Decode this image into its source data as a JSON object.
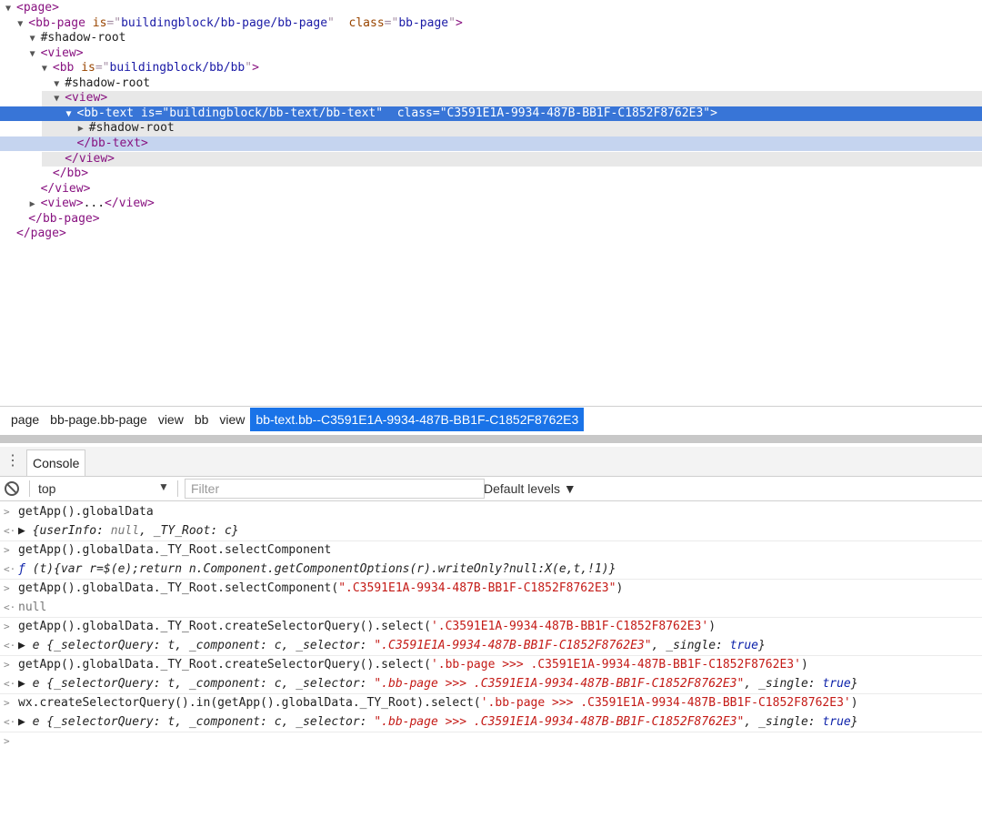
{
  "elements": {
    "nodes": [
      {
        "indent": 0,
        "tri": "▼",
        "parts": [
          [
            "tag",
            "<page"
          ],
          [
            "tag",
            ">"
          ]
        ]
      },
      {
        "indent": 1,
        "tri": "▼",
        "parts": [
          [
            "tag",
            "<bb-page"
          ],
          [
            "plain",
            " "
          ],
          [
            "attr",
            "is"
          ],
          [
            "punc",
            "=\""
          ],
          [
            "val",
            "buildingblock/bb-page/bb-page"
          ],
          [
            "punc",
            "\""
          ],
          [
            "plain",
            "  "
          ],
          [
            "attr",
            "class"
          ],
          [
            "punc",
            "=\""
          ],
          [
            "val",
            "bb-page"
          ],
          [
            "punc",
            "\""
          ],
          [
            "tag",
            ">"
          ]
        ]
      },
      {
        "indent": 2,
        "tri": "▼",
        "parts": [
          [
            "plain",
            "#shadow-root"
          ]
        ]
      },
      {
        "indent": 2,
        "tri": "▼",
        "parts": [
          [
            "tag",
            "<view"
          ],
          [
            "tag",
            ">"
          ]
        ]
      },
      {
        "indent": 3,
        "tri": "▼",
        "parts": [
          [
            "tag",
            "<bb"
          ],
          [
            "plain",
            " "
          ],
          [
            "attr",
            "is"
          ],
          [
            "punc",
            "=\""
          ],
          [
            "val",
            "buildingblock/bb/bb"
          ],
          [
            "punc",
            "\""
          ],
          [
            "tag",
            ">"
          ]
        ]
      },
      {
        "indent": 4,
        "tri": "▼",
        "parts": [
          [
            "plain",
            "#shadow-root"
          ]
        ]
      },
      {
        "indent": 4,
        "tri": "▼",
        "parts": [
          [
            "tag",
            "<view"
          ],
          [
            "tag",
            ">"
          ]
        ],
        "bg": "light"
      },
      {
        "indent": 5,
        "tri": "▼",
        "parts": [
          [
            "tag",
            "<bb-text"
          ],
          [
            "plain",
            " "
          ],
          [
            "attr",
            "is"
          ],
          [
            "punc",
            "=\""
          ],
          [
            "val",
            "buildingblock/bb-text/bb-text"
          ],
          [
            "punc",
            "\""
          ],
          [
            "plain",
            "  "
          ],
          [
            "attr",
            "class"
          ],
          [
            "punc",
            "=\""
          ],
          [
            "val",
            "C3591E1A-9934-487B-BB1F-C1852F8762E3"
          ],
          [
            "punc",
            "\""
          ],
          [
            "tag",
            ">"
          ]
        ],
        "bg": "sel"
      },
      {
        "indent": 6,
        "tri": "▶",
        "parts": [
          [
            "plain",
            "#shadow-root"
          ]
        ],
        "bg": "light"
      },
      {
        "indent": 5,
        "tri": "",
        "parts": [
          [
            "tag",
            "</bb-text"
          ],
          [
            "tag",
            ">"
          ]
        ],
        "bg": "hover"
      },
      {
        "indent": 4,
        "tri": "",
        "parts": [
          [
            "tag",
            "</view"
          ],
          [
            "tag",
            ">"
          ]
        ],
        "bg": "light"
      },
      {
        "indent": 3,
        "tri": "",
        "parts": [
          [
            "tag",
            "</bb"
          ],
          [
            "tag",
            ">"
          ]
        ]
      },
      {
        "indent": 2,
        "tri": "",
        "parts": [
          [
            "tag",
            "</view"
          ],
          [
            "tag",
            ">"
          ]
        ]
      },
      {
        "indent": 2,
        "tri": "▶",
        "parts": [
          [
            "tag",
            "<view"
          ],
          [
            "tag",
            ">"
          ],
          [
            "plain",
            "..."
          ],
          [
            "tag",
            "</view"
          ],
          [
            "tag",
            ">"
          ]
        ]
      },
      {
        "indent": 1,
        "tri": "",
        "parts": [
          [
            "tag",
            "</bb-page"
          ],
          [
            "tag",
            ">"
          ]
        ]
      },
      {
        "indent": 0,
        "tri": "",
        "parts": [
          [
            "tag",
            "</page"
          ],
          [
            "tag",
            ">"
          ]
        ]
      }
    ]
  },
  "breadcrumbs": [
    {
      "label": "page"
    },
    {
      "label": "bb-page.bb-page"
    },
    {
      "label": "view"
    },
    {
      "label": "bb"
    },
    {
      "label": "view"
    },
    {
      "label": "bb-text.bb--C3591E1A-9934-487B-BB1F-C1852F8762E3",
      "active": true
    }
  ],
  "drawer": {
    "menu_icon": "⋮",
    "tab_label": "Console"
  },
  "toolbar": {
    "context": "top",
    "context_arrow": "▼",
    "filter_placeholder": "Filter",
    "levels_label": "Default levels ▼"
  },
  "console": {
    "rows": [
      {
        "prompt": ">",
        "parts": [
          [
            "cmd",
            "getApp().globalData"
          ]
        ]
      },
      {
        "prompt": "<·",
        "parts": [
          [
            "cmd",
            "▶ "
          ],
          [
            "cmd it",
            "{userInfo: "
          ],
          [
            "gray it",
            "null"
          ],
          [
            "cmd it",
            ", _TY_Root: c}"
          ]
        ],
        "sep": true
      },
      {
        "prompt": ">",
        "parts": [
          [
            "cmd",
            "getApp().globalData._TY_Root.selectComponent"
          ]
        ]
      },
      {
        "prompt": "<·",
        "parts": [
          [
            "fn it",
            "ƒ "
          ],
          [
            "cmd it",
            "(t){var r=$(e);return n.Component.getComponentOptions(r).writeOnly?null:X(e,t,!1)}"
          ]
        ],
        "sep": true
      },
      {
        "prompt": ">",
        "parts": [
          [
            "cmd",
            "getApp().globalData._TY_Root.selectComponent("
          ],
          [
            "str",
            "\".C3591E1A-9934-487B-BB1F-C1852F8762E3\""
          ],
          [
            "cmd",
            ")"
          ]
        ]
      },
      {
        "prompt": "<·",
        "parts": [
          [
            "gray",
            "null"
          ]
        ],
        "sep": true
      },
      {
        "prompt": ">",
        "parts": [
          [
            "cmd",
            "getApp().globalData._TY_Root.createSelectorQuery().select("
          ],
          [
            "str",
            "'.C3591E1A-9934-487B-BB1F-C1852F8762E3'"
          ],
          [
            "cmd",
            ")"
          ]
        ]
      },
      {
        "prompt": "<·",
        "parts": [
          [
            "cmd",
            "▶ "
          ],
          [
            "cmd it",
            "e {_selectorQuery: t, _component: c, _selector: "
          ],
          [
            "str it",
            "\".C3591E1A-9934-487B-BB1F-C1852F8762E3\""
          ],
          [
            "cmd it",
            ", _single: "
          ],
          [
            "kw it",
            "true"
          ],
          [
            "cmd it",
            "}"
          ]
        ],
        "sep": true
      },
      {
        "prompt": ">",
        "parts": [
          [
            "cmd",
            "getApp().globalData._TY_Root.createSelectorQuery().select("
          ],
          [
            "str",
            "'.bb-page >>> .C3591E1A-9934-487B-BB1F-C1852F8762E3'"
          ],
          [
            "cmd",
            ")"
          ]
        ]
      },
      {
        "prompt": "<·",
        "parts": [
          [
            "cmd",
            "▶ "
          ],
          [
            "cmd it",
            "e {_selectorQuery: t, _component: c, _selector: "
          ],
          [
            "str it",
            "\".bb-page >>> .C3591E1A-9934-487B-BB1F-C1852F8762E3\""
          ],
          [
            "cmd it",
            ", _single: "
          ],
          [
            "kw it",
            "true"
          ],
          [
            "cmd it",
            "}"
          ]
        ],
        "sep": true
      },
      {
        "prompt": ">",
        "parts": [
          [
            "cmd",
            "wx.createSelectorQuery().in(getApp().globalData._TY_Root).select("
          ],
          [
            "str",
            "'.bb-page >>> .C3591E1A-9934-487B-BB1F-C1852F8762E3'"
          ],
          [
            "cmd",
            ")"
          ]
        ]
      },
      {
        "prompt": "<·",
        "parts": [
          [
            "cmd",
            "▶ "
          ],
          [
            "cmd it",
            "e {_selectorQuery: t, _component: c, _selector: "
          ],
          [
            "str it",
            "\".bb-page >>> .C3591E1A-9934-487B-BB1F-C1852F8762E3\""
          ],
          [
            "cmd it",
            ", _single: "
          ],
          [
            "kw it",
            "true"
          ],
          [
            "cmd it",
            "}"
          ]
        ],
        "sep": true
      },
      {
        "prompt": ">",
        "parts": [],
        "input": true
      }
    ]
  }
}
